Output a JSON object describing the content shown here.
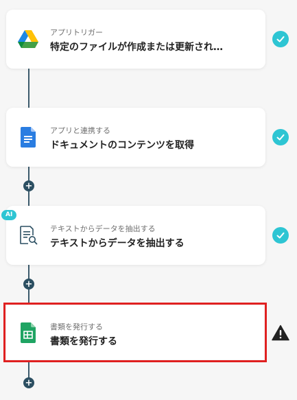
{
  "steps": [
    {
      "sub": "アプリトリガー",
      "title": "特定のファイルが作成または更新され…",
      "icon": "google-drive-icon",
      "status": "check-icon"
    },
    {
      "sub": "アプリと連携する",
      "title": "ドキュメントのコンテンツを取得",
      "icon": "google-docs-icon",
      "status": "check-icon"
    },
    {
      "badge": "AI",
      "sub": "テキストからデータを抽出する",
      "title": "テキストからデータを抽出する",
      "icon": "document-search-icon",
      "status": "check-icon"
    },
    {
      "sub": "書類を発行する",
      "title": "書類を発行する",
      "icon": "google-sheets-icon",
      "status": "warning-icon"
    }
  ],
  "add_step_symbol": "+",
  "colors": {
    "check": "#2ec5d3",
    "connector": "#2c4f62",
    "highlight": "#e02020",
    "warning": "#222222"
  }
}
